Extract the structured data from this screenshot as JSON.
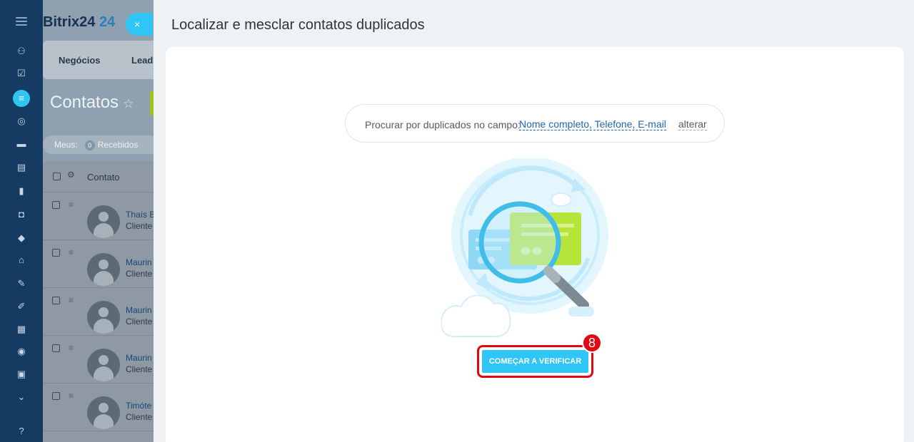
{
  "rail": {
    "icons": [
      "menu-icon",
      "activity-icon",
      "tasks-icon",
      "crm-filter-icon",
      "target-icon",
      "cart-icon",
      "contact-card-icon",
      "reports-icon",
      "robot-icon",
      "box-icon",
      "bank-icon",
      "signature-icon",
      "document-icon",
      "calendar-icon",
      "record-icon",
      "workflow-icon",
      "more-icon",
      "help-icon"
    ]
  },
  "crm": {
    "brand": "Bitrix24",
    "brand_number": "24",
    "tabs": [
      "Negócios",
      "Leads"
    ],
    "page_title": "Contatos",
    "filter": {
      "mine_label": "Meus:",
      "received_count": "0",
      "received_label": "Recebidos"
    },
    "grid": {
      "column_header": "Contato",
      "rows": [
        {
          "name": "Thaís B",
          "type": "Cliente"
        },
        {
          "name": "Maurin",
          "type": "Cliente"
        },
        {
          "name": "Maurin",
          "type": "Cliente"
        },
        {
          "name": "Maurin",
          "type": "Cliente"
        },
        {
          "name": "Timóte",
          "type": "Cliente"
        }
      ]
    }
  },
  "slider": {
    "close_symbol": "×",
    "title": "Localizar e mesclar contatos duplicados",
    "search_prefix": "Procurar por duplicados no campo:",
    "search_fields": "Nome completo, Telefone, E-mail",
    "change_link": "alterar",
    "start_button": "COMEÇAR A VERIFICAR",
    "step_badge": "8"
  },
  "colors": {
    "accent": "#2fc6f6",
    "highlight": "#e30613",
    "link": "#2067b0",
    "rail": "#153b63"
  }
}
